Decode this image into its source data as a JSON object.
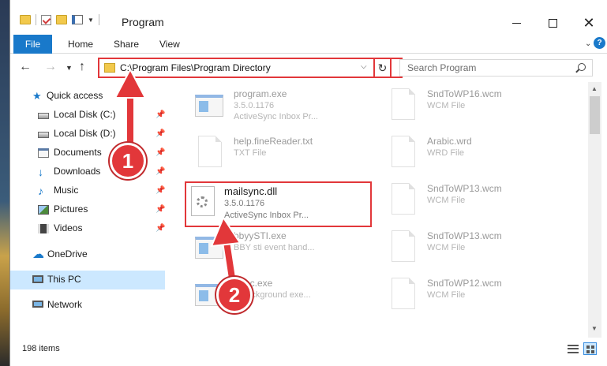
{
  "window": {
    "title": "Program"
  },
  "ribbon": {
    "file": "File",
    "home": "Home",
    "share": "Share",
    "view": "View",
    "help": "?"
  },
  "address": {
    "path": "C:\\Program Files\\Program Directory",
    "search_placeholder": "Search Program"
  },
  "nav": {
    "quick_access": "Quick access",
    "items": [
      {
        "label": "Local Disk (C:)",
        "icon": "disk-icon"
      },
      {
        "label": "Local Disk (D:)",
        "icon": "disk-icon"
      },
      {
        "label": "Documents",
        "icon": "documents-icon"
      },
      {
        "label": "Downloads",
        "icon": "downloads-icon"
      },
      {
        "label": "Music",
        "icon": "music-icon"
      },
      {
        "label": "Pictures",
        "icon": "pictures-icon"
      },
      {
        "label": "Videos",
        "icon": "videos-icon"
      }
    ],
    "onedrive": "OneDrive",
    "this_pc": "This PC",
    "network": "Network"
  },
  "files": {
    "col1": [
      {
        "name": "program.exe",
        "l2": "3.5.0.1176",
        "l3": "ActiveSync Inbox Pr..."
      },
      {
        "name": "help.fineReader.txt",
        "l2": "TXT File",
        "l3": ""
      },
      {
        "name": "mailsync.dll",
        "l2": "3.5.0.1176",
        "l3": "ActiveSync Inbox Pr..."
      },
      {
        "name": "bbyySTI.exe",
        "l2": "BBY sti event hand...",
        "l3": ""
      },
      {
        "name": "Exec.exe",
        "l2": "Y background exe...",
        "l3": ""
      }
    ],
    "col2": [
      {
        "name": "SndToWP16.wcm",
        "l2": "WCM File"
      },
      {
        "name": "Arabic.wrd",
        "l2": "WRD File"
      },
      {
        "name": "SndToWP13.wcm",
        "l2": "WCM File"
      },
      {
        "name": "SndToWP13.wcm",
        "l2": "WCM File"
      },
      {
        "name": "SndToWP12.wcm",
        "l2": "WCM File"
      }
    ]
  },
  "status": {
    "count": "198 items"
  },
  "annotations": {
    "step1": "1",
    "step2": "2",
    "color": "#e2373a"
  }
}
